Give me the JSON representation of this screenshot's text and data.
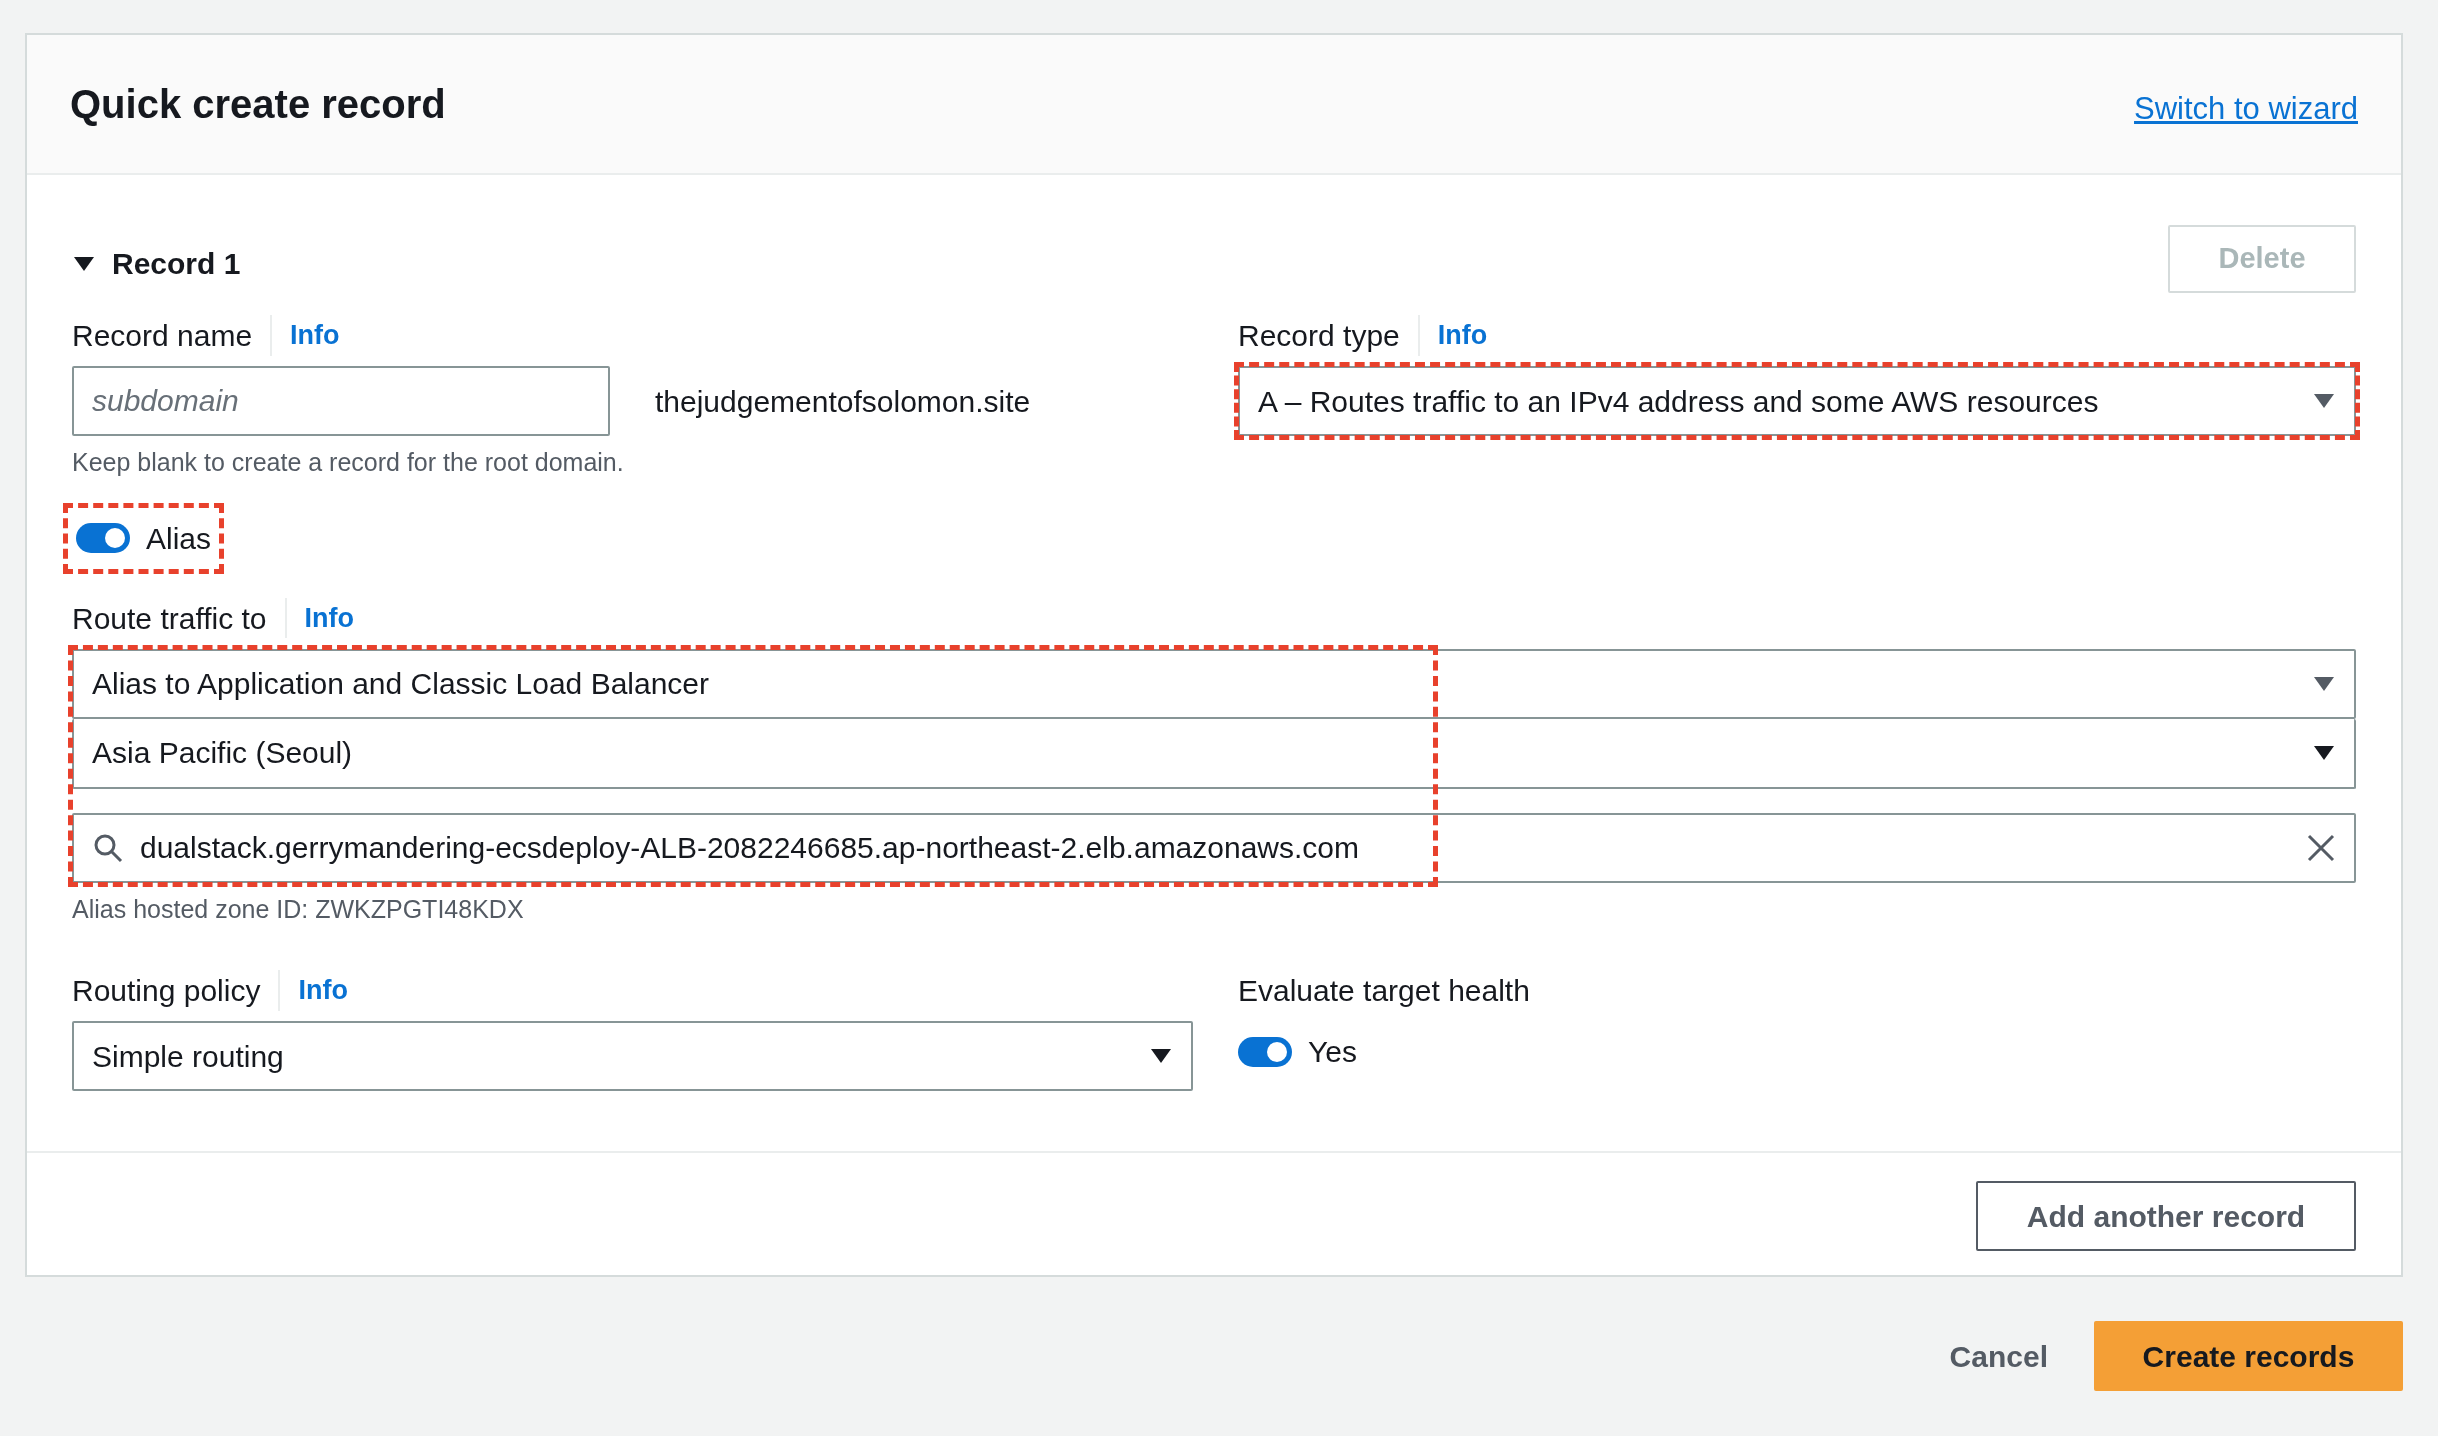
{
  "header": {
    "title": "Quick create record",
    "link": "Switch to wizard"
  },
  "record": {
    "title": "Record 1",
    "expanded": true,
    "delete_button": {
      "label": "Delete",
      "disabled": true
    },
    "record_name": {
      "label": "Record name",
      "info": "Info",
      "placeholder": "subdomain",
      "suffix": "thejudgementofsolomon.site",
      "hint": "Keep blank to create a record for the root domain."
    },
    "record_type": {
      "label": "Record type",
      "info": "Info",
      "value": "A – Routes traffic to an IPv4 address and some AWS resources",
      "highlighted": true
    },
    "alias": {
      "label": "Alias",
      "on": true,
      "highlighted": true
    },
    "route_traffic": {
      "label": "Route traffic to",
      "info": "Info",
      "highlighted": true,
      "endpoint_type": "Alias to Application and Classic Load Balancer",
      "region": "Asia Pacific (Seoul)",
      "search_value": "dualstack.gerrymandering-ecsdeploy-ALB-2082246685.ap-northeast-2.elb.amazonaws.com",
      "hint": "Alias hosted zone ID: ZWKZPGTI48KDX"
    },
    "routing_policy": {
      "label": "Routing policy",
      "info": "Info",
      "value": "Simple routing"
    },
    "evaluate_target_health": {
      "label": "Evaluate target health",
      "on": true,
      "toggle_label": "Yes"
    },
    "add_button": "Add another record"
  },
  "footer": {
    "cancel": "Cancel",
    "create": "Create records"
  }
}
